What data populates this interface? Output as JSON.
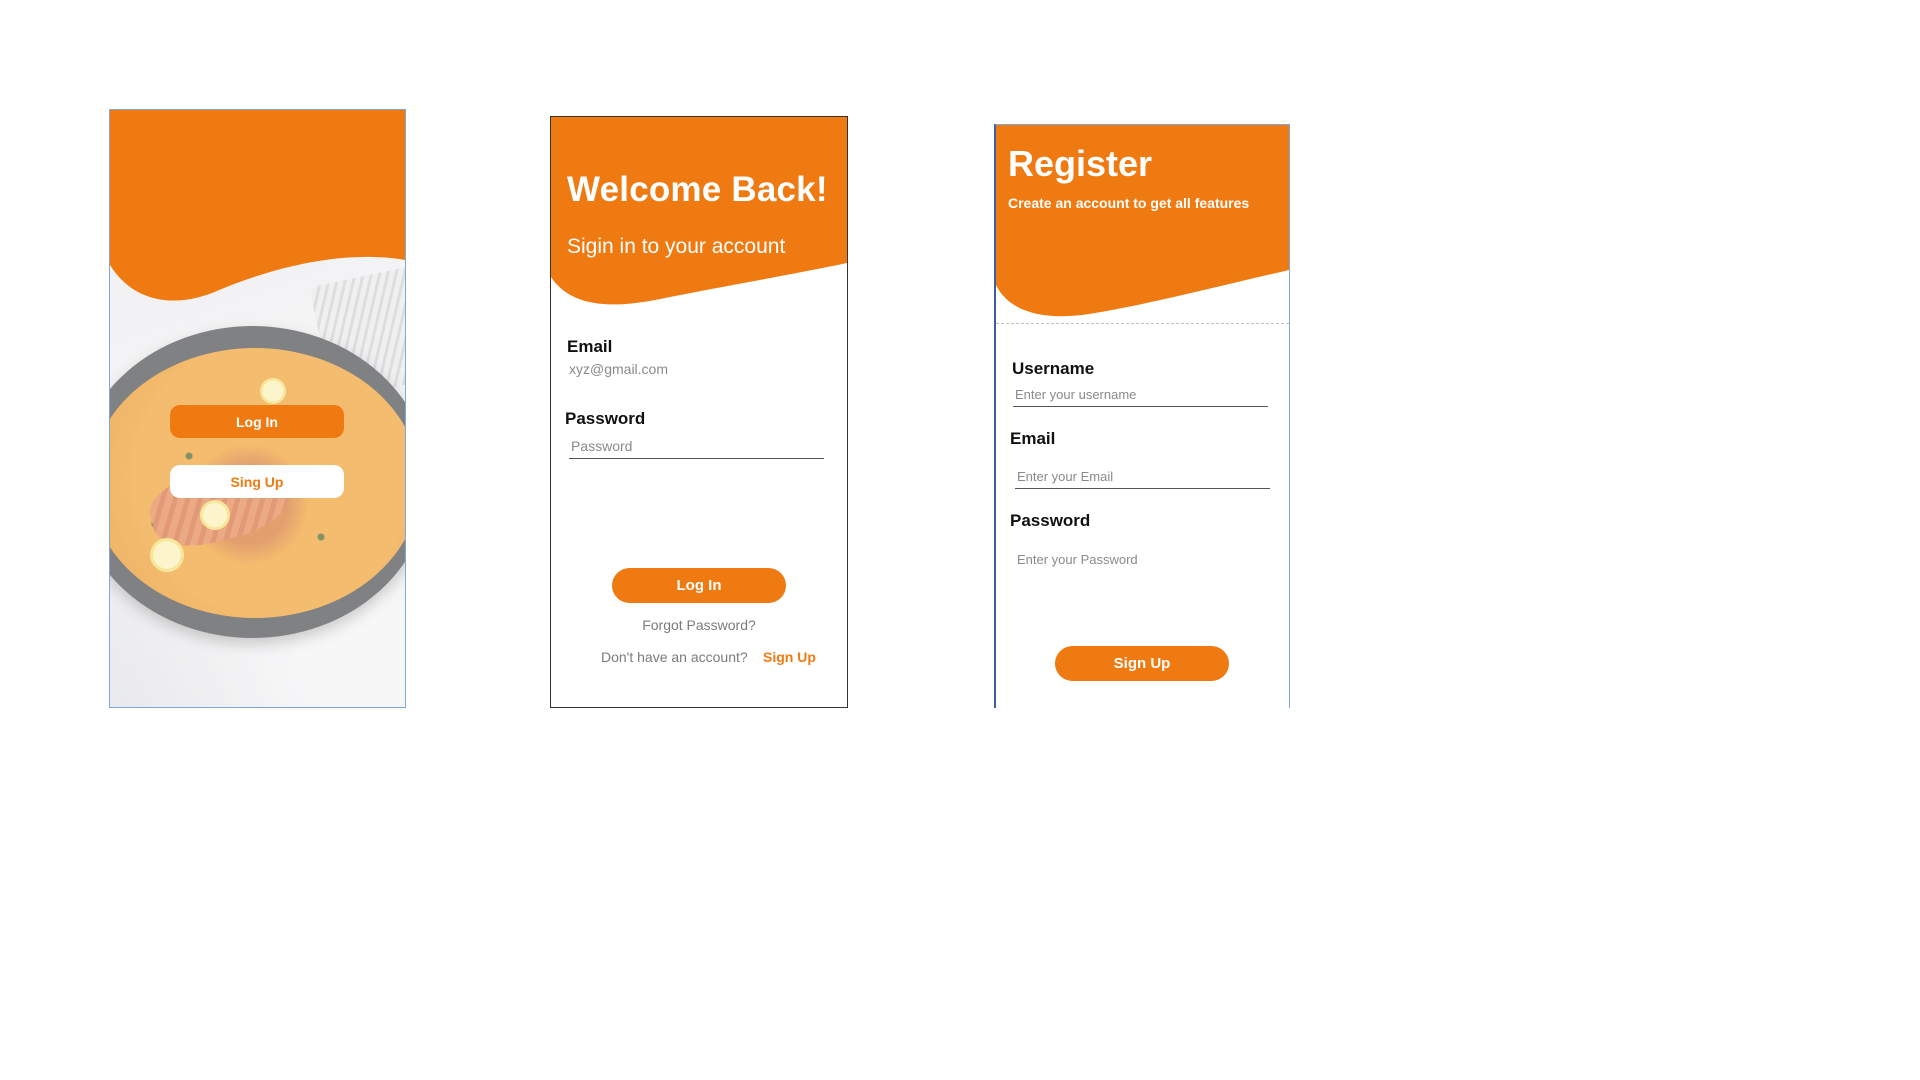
{
  "colors": {
    "accent": "#F07A12",
    "background": "#FFFFFF",
    "text": "#111111",
    "muted": "#7B7B7B"
  },
  "welcome_screen": {
    "login_label": "Log In",
    "signup_label": "Sing Up",
    "background_image": "curry-pan-photo"
  },
  "login_screen": {
    "title": "Welcome Back!",
    "subtitle": "Sigin in to your account",
    "email_label": "Email",
    "email_placeholder": "xyz@gmail.com",
    "password_label": "Password",
    "password_placeholder": "Password",
    "login_button": "Log In",
    "forgot_password": "Forgot Password?",
    "no_account_text": "Don't have an account?",
    "signup_link": "Sign Up"
  },
  "register_screen": {
    "title": "Register",
    "subtitle": "Create an account to get all features",
    "username_label": "Username",
    "username_placeholder": "Enter your username",
    "email_label": "Email",
    "email_placeholder": "Enter your Email",
    "password_label": "Password",
    "password_placeholder": "Enter your Password",
    "signup_button": "Sign Up"
  }
}
